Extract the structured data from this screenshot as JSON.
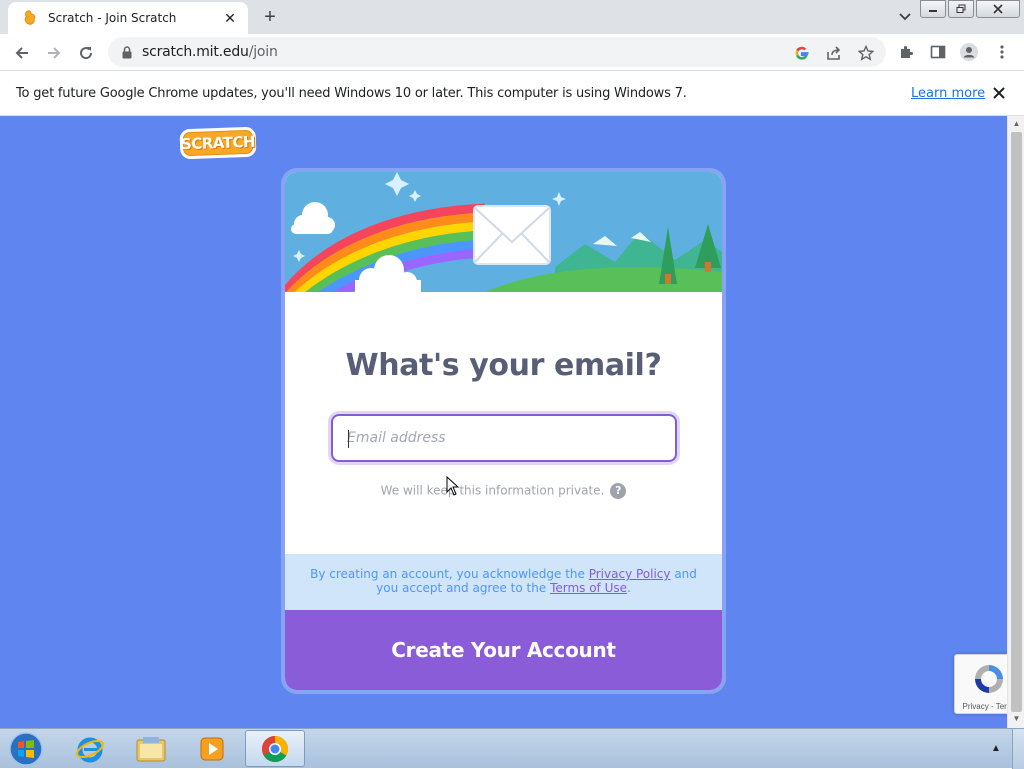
{
  "browser": {
    "tab": {
      "title": "Scratch - Join Scratch",
      "favicon": "scratch-cat-icon"
    },
    "url": {
      "host": "scratch.mit.edu",
      "path": "/join"
    },
    "icons": [
      "back-icon",
      "forward-icon",
      "reload-icon",
      "lock-icon",
      "google-icon",
      "share-icon",
      "star-icon",
      "extensions-icon",
      "side-panel-icon",
      "profile-icon",
      "menu-icon"
    ]
  },
  "infobar": {
    "message": "To get future Google Chrome updates, you'll need Windows 10 or later. This computer is using Windows 7.",
    "link": "Learn more"
  },
  "page": {
    "logo_text": "SCRATCH",
    "heading": "What's your email?",
    "email_placeholder": "Email address",
    "email_value": "",
    "privacy_note": "We will keep this information private.",
    "help_glyph": "?",
    "legal": {
      "part1": "By creating an account, you acknowledge the ",
      "privacy_link": "Privacy Policy",
      "part2": " and you accept and agree to the ",
      "terms_link": "Terms of Use",
      "part3": "."
    },
    "create_button": "Create Your Account",
    "recaptcha_text": "Privacy - Terms"
  },
  "colors": {
    "page_bg": "#5f85f0",
    "accent_purple": "#855cd6",
    "heading": "#575e75",
    "legal_bg": "#d0e4fa"
  },
  "taskbar": {
    "apps": [
      "start-orb-icon",
      "internet-explorer-icon",
      "file-explorer-icon",
      "media-player-icon",
      "chrome-icon"
    ]
  }
}
